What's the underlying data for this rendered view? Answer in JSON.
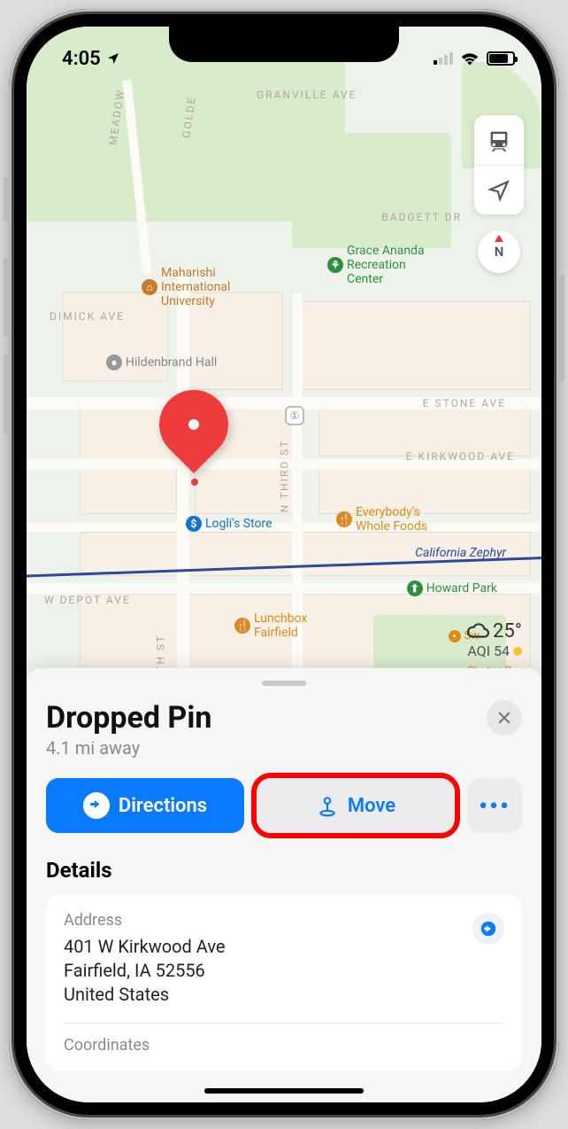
{
  "status": {
    "time": "4:05"
  },
  "weather": {
    "temp": "25°",
    "aqi": "AQI 54"
  },
  "compass": "N",
  "map": {
    "roads": {
      "granville": "GRANVILLE AVE",
      "meadow": "MEADOW",
      "golden": "GOLDE",
      "badgett": "BADGETT DR",
      "dimick": "DIMICK AVE",
      "estone": "E STONE AVE",
      "ekirkwood": "E KIRKWOOD AVE",
      "nthird": "N THIRD ST",
      "wdepot": "W DEPOT AVE",
      "nsixth": "N SIXTH ST"
    },
    "pois": {
      "miu": "Maharishi\nInternational\nUniversity",
      "grace": "Grace Ananda\nRecreation\nCenter",
      "hildenbrand": "Hildenbrand Hall",
      "logli": "Logli's Store",
      "everybody": "Everybody's\nWhole Foods",
      "howard": "Howard Park",
      "lunchbox": "Lunchbox\nFairfield",
      "fairfield": "Fairfield",
      "shokai": "Shokai Sus\nFairfield",
      "sw": "Sw"
    },
    "rail": "California Zephyr"
  },
  "sheet": {
    "title": "Dropped Pin",
    "subtitle": "4.1 mi away",
    "directions": "Directions",
    "move": "Move",
    "more": "•••",
    "details_heading": "Details",
    "address_label": "Address",
    "address_line1": "401 W Kirkwood Ave",
    "address_line2": "Fairfield, IA  52556",
    "address_line3": "United States",
    "coordinates_label": "Coordinates"
  }
}
